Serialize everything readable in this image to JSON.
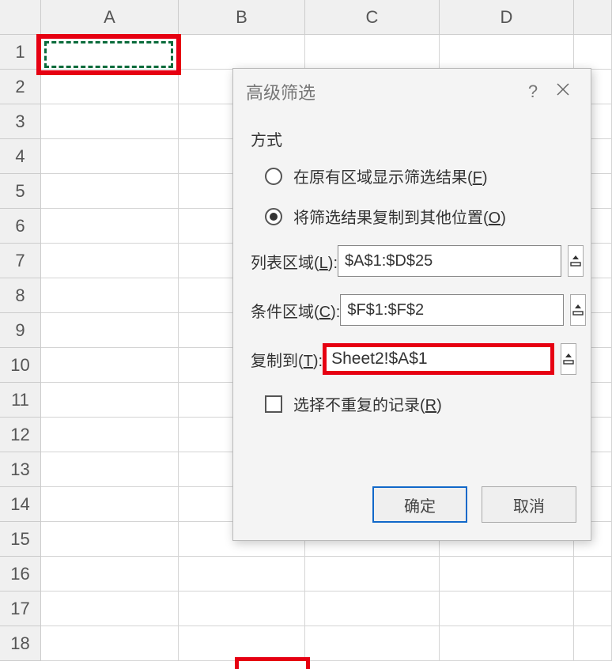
{
  "sheet": {
    "columns": [
      "A",
      "B",
      "C",
      "D"
    ],
    "rows": [
      "1",
      "2",
      "3",
      "4",
      "5",
      "6",
      "7",
      "8",
      "9",
      "10",
      "11",
      "12",
      "13",
      "14",
      "15",
      "16",
      "17",
      "18"
    ]
  },
  "dialog": {
    "title": "高级筛选",
    "help": "?",
    "section_method": "方式",
    "radio_in_place_prefix": "在原有区域显示筛选结果(",
    "radio_in_place_key": "F",
    "radio_in_place_suffix": ")",
    "radio_copy_prefix": "将筛选结果复制到其他位置(",
    "radio_copy_key": "O",
    "radio_copy_suffix": ")",
    "label_list_prefix": "列表区域(",
    "label_list_key": "L",
    "label_list_suffix": "):",
    "value_list": "$A$1:$D$25",
    "label_criteria_prefix": "条件区域(",
    "label_criteria_key": "C",
    "label_criteria_suffix": "):",
    "value_criteria": "$F$1:$F$2",
    "label_copyto_prefix": "复制到(",
    "label_copyto_key": "T",
    "label_copyto_suffix": "):",
    "value_copyto": "Sheet2!$A$1",
    "check_unique_prefix": "选择不重复的记录(",
    "check_unique_key": "R",
    "check_unique_suffix": ")",
    "btn_ok": "确定",
    "btn_cancel": "取消"
  }
}
